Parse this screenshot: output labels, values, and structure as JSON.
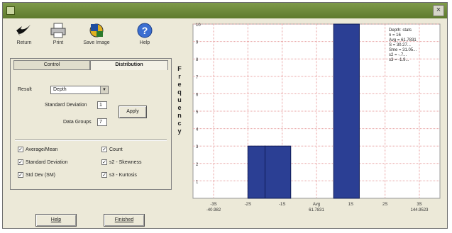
{
  "window": {
    "title": "",
    "close_label": "×"
  },
  "toolbar": {
    "return_label": "Return",
    "print_label": "Print",
    "save_image_label": "Save Image",
    "help_label": "Help"
  },
  "tabs": {
    "control": "Control",
    "distribution": "Distribution"
  },
  "form": {
    "result_label": "Result",
    "result_value": "Depth",
    "std_dev_label": "Standard Deviation",
    "std_dev_value": "1",
    "data_groups_label": "Data Groups",
    "data_groups_value": "7",
    "apply_label": "Apply"
  },
  "checkboxes": [
    {
      "label": "Average/Mean",
      "checked": true
    },
    {
      "label": "Count",
      "checked": true
    },
    {
      "label": "Standard Deviation",
      "checked": true
    },
    {
      "label": "s2 - Skewness",
      "checked": true
    },
    {
      "label": "Std Dev (SM)",
      "checked": true
    },
    {
      "label": "s3 - Kurtosis",
      "checked": true
    }
  ],
  "buttons": {
    "help_label": "Help",
    "finished_label": "Finished"
  },
  "axis": {
    "y_title": "Frequency"
  },
  "chart_data": {
    "type": "bar",
    "ylim": [
      0,
      10
    ],
    "y_ticks": [
      1,
      2,
      3,
      4,
      5,
      6,
      7,
      8,
      9,
      10
    ],
    "grid": true,
    "x_ticks": [
      "-3S\n-40.982",
      "-2S",
      "-1S",
      "Avg\n61.7831",
      "1S",
      "2S",
      "3S\n144.9523"
    ],
    "series": [
      {
        "name": "",
        "values": [
          {
            "x0": -2,
            "x1": -1.5,
            "value": 3
          },
          {
            "x0": -1.5,
            "x1": -0.75,
            "value": 3
          },
          {
            "x0": 0.5,
            "x1": 1.25,
            "value": 10
          }
        ]
      }
    ],
    "bar_color": "#2b3f94",
    "stats": [
      "Depth: stats",
      "n = 16",
      "Avg = 61.7831",
      "S = 30.27...",
      "Sme = 31.05...",
      "s2 = -.7...",
      "s3 = -1.9..."
    ]
  },
  "colors": {
    "bar": "#2b3f94",
    "grid": "#e8a0a0",
    "titlebar": "#6b8a3a"
  }
}
